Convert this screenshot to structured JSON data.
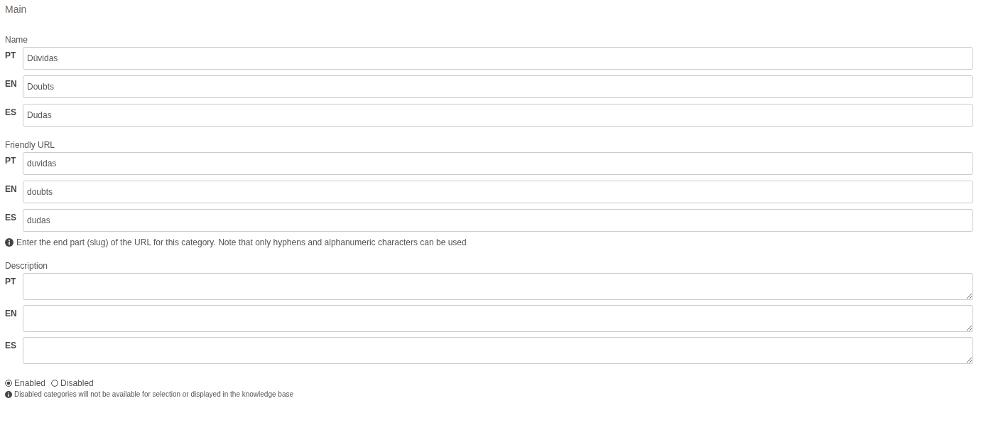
{
  "section_title": "Main",
  "groups": [
    {
      "label": "Name",
      "kind": "input",
      "fields": [
        {
          "lang": "PT",
          "value": "Dúvidas"
        },
        {
          "lang": "EN",
          "value": "Doubts"
        },
        {
          "lang": "ES",
          "value": "Dudas"
        }
      ]
    },
    {
      "label": "Friendly URL",
      "kind": "input",
      "fields": [
        {
          "lang": "PT",
          "value": "duvidas"
        },
        {
          "lang": "EN",
          "value": "doubts"
        },
        {
          "lang": "ES",
          "value": "dudas"
        }
      ],
      "hint": "Enter the end part (slug) of the URL for this category. Note that only hyphens and alphanumeric characters can be used"
    },
    {
      "label": "Description",
      "kind": "textarea",
      "fields": [
        {
          "lang": "PT"
        },
        {
          "lang": "EN"
        },
        {
          "lang": "ES"
        }
      ]
    }
  ],
  "status_options": [
    {
      "label": "Enabled",
      "selected": true
    },
    {
      "label": "Disabled",
      "selected": false
    }
  ],
  "status_note": "Disabled categories will not be available for selection or displayed in the knowledge base"
}
